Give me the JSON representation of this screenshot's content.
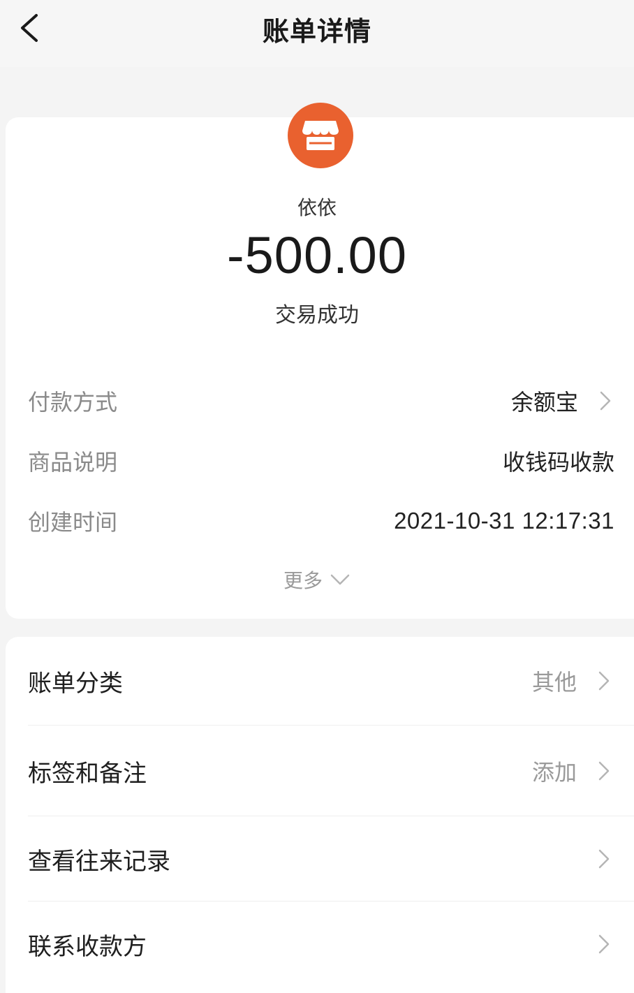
{
  "header": {
    "title": "账单详情"
  },
  "merchant": {
    "icon": "storefront-icon",
    "name": "依依"
  },
  "transaction": {
    "amount": "-500.00",
    "status": "交易成功"
  },
  "details": [
    {
      "label": "付款方式",
      "value": "余额宝",
      "has_chevron": true
    },
    {
      "label": "商品说明",
      "value": "收钱码收款",
      "has_chevron": false
    },
    {
      "label": "创建时间",
      "value": "2021-10-31 12:17:31",
      "has_chevron": false
    }
  ],
  "more": {
    "label": "更多"
  },
  "actions": [
    {
      "label": "账单分类",
      "value": "其他"
    },
    {
      "label": "标签和备注",
      "value": "添加"
    },
    {
      "label": "查看往来记录",
      "value": ""
    },
    {
      "label": "联系收款方",
      "value": ""
    }
  ],
  "colors": {
    "accent": "#e9612f",
    "background": "#f4f4f4",
    "card": "#ffffff",
    "muted_text": "#8a8a8a"
  }
}
